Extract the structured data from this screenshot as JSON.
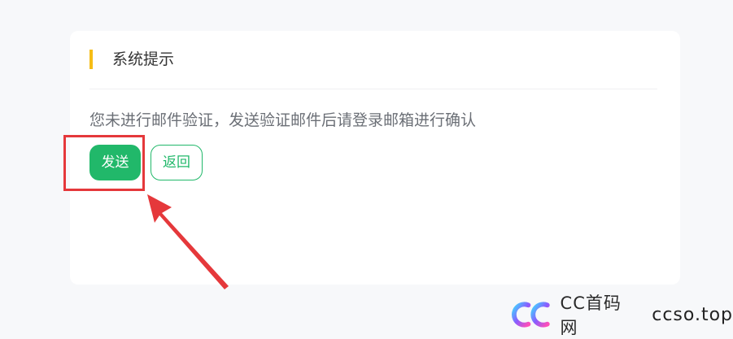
{
  "notice": {
    "title": "系统提示",
    "message": "您未进行邮件验证，发送验证邮件后请登录邮箱进行确认",
    "send_label": "发送",
    "back_label": "返回"
  },
  "watermark": {
    "name": "CC首码网",
    "domain": "ccso.top"
  },
  "colors": {
    "accent": "#f6bd16",
    "primary_green": "#21b86a",
    "annotation_red": "#e5383b"
  },
  "icons": {
    "annotation": "red-arrow",
    "watermark_logo": "cc-logo-icon"
  }
}
